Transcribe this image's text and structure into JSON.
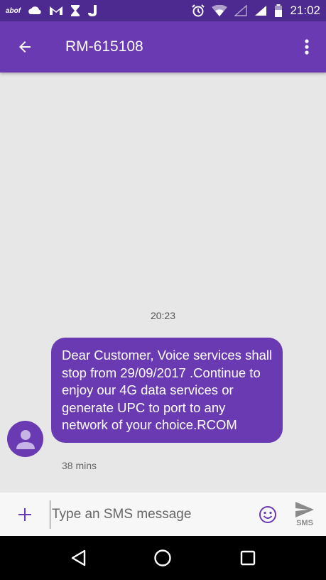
{
  "status_bar": {
    "carrier_label": "abof",
    "time": "21:02",
    "icons": [
      "cloud-icon",
      "gmail-icon",
      "hourglass-icon",
      "j-app-icon",
      "alarm-icon",
      "wifi-icon",
      "signal-empty-icon",
      "signal-icon",
      "battery-icon"
    ]
  },
  "header": {
    "title": "RM-615108",
    "back_icon": "arrow-back-icon",
    "menu_icon": "more-vert-icon"
  },
  "conversation": {
    "timestamp": "20:23",
    "message": {
      "text": "Dear Customer, Voice services shall stop from 29/09/2017 .Continue to enjoy our 4G data services or generate UPC to port to any network of your choice.RCOM",
      "age": "38 mins"
    }
  },
  "compose": {
    "placeholder": "Type an SMS message",
    "send_label": "SMS",
    "add_icon": "plus-icon",
    "emoji_icon": "emoji-icon",
    "send_icon": "send-icon"
  },
  "nav_bar": {
    "icons": [
      "back-triangle-icon",
      "home-circle-icon",
      "recents-square-icon"
    ]
  },
  "colors": {
    "status_bar": "#4d2a8f",
    "app_bar": "#6a3ab2",
    "bubble": "#6a3ab2",
    "background": "#e7e7e7",
    "accent": "#6a3ab2"
  }
}
